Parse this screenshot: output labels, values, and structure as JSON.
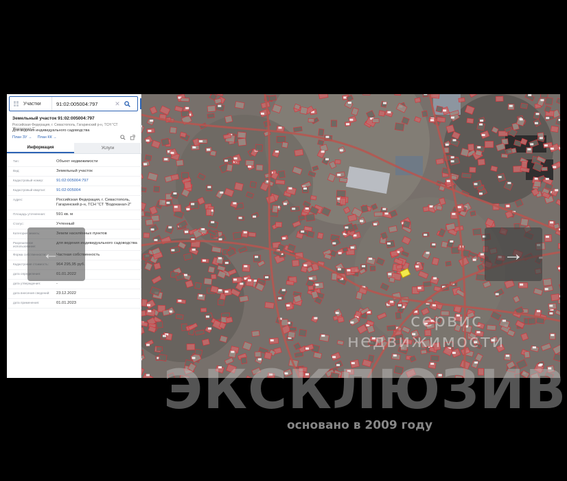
{
  "search": {
    "layer_label": "Участки",
    "query": "91:02:005004:797"
  },
  "object": {
    "title": "Земельный участок 91:02:005004:797",
    "address_short": "Российская Федерация, г. Севастополь, Гагаринский р-н, ТСН \"СТ \"Водоканал-2\"",
    "purpose": "Для ведения индивидуального садоводства",
    "plan_zu": "План ЗУ →",
    "plan_kk": "План КК →"
  },
  "tabs": {
    "info": "Информация",
    "services": "Услуги"
  },
  "properties": [
    {
      "key": "Тип:",
      "value": "Объект недвижимости"
    },
    {
      "key": "Вид:",
      "value": "Земельный участок"
    },
    {
      "key": "Кадастровый номер:",
      "value": "91:02:005004:797",
      "link": true
    },
    {
      "key": "Кадастровый квартал:",
      "value": "91:02:005004",
      "link": true
    },
    {
      "key": "Адрес:",
      "value": "Российская Федерация, г. Севастополь, Гагаринский р-н, ТСН \"СТ \"Водоканал-2\""
    },
    {
      "key": "Площадь уточненная:",
      "value": "591 кв. м"
    },
    {
      "key": "Статус:",
      "value": "Учтенный"
    },
    {
      "key": "Категория земель:",
      "value": "Земли населённых пунктов"
    },
    {
      "key": "Разрешенное использование:",
      "value": "для ведения индивидуального садоводства"
    },
    {
      "key": "Форма собственности:",
      "value": "Частная собственность"
    },
    {
      "key": "Кадастровая стоимость:",
      "value": "964 295,95 руб."
    },
    {
      "key": "дата определения:",
      "value": "01.01.2022"
    },
    {
      "key": "дата утверждения:",
      "value": "-"
    },
    {
      "key": "дата внесения сведений:",
      "value": "23.12.2022"
    },
    {
      "key": "дата применения:",
      "value": "01.01.2023"
    }
  ],
  "watermark": {
    "service_line1": "сервис",
    "service_line2": "недвижимости",
    "brand": "ЭКСКЛЮЗИВ",
    "brand_sub": "основано в 2009 году"
  },
  "colors": {
    "accent": "#2c63b4",
    "parcel_outline": "#d8323a",
    "selected_parcel": "#f2e94c"
  },
  "icons": {
    "search": "magnifier-icon",
    "clear": "close-icon",
    "prev": "arrow-left-icon",
    "next": "arrow-right-icon"
  }
}
